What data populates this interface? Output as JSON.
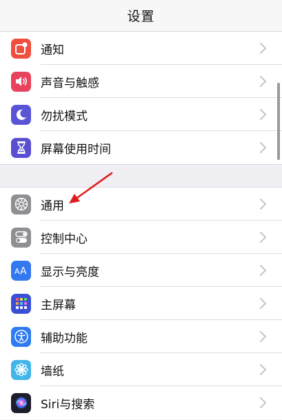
{
  "nav": {
    "title": "设置"
  },
  "group1": [
    {
      "label": "通知",
      "icon": "notifications-icon",
      "color": "#ee4f3e"
    },
    {
      "label": "声音与触感",
      "icon": "sound-icon",
      "color": "#e8435d"
    },
    {
      "label": "勿扰模式",
      "icon": "moon-icon",
      "color": "#5a55d6"
    },
    {
      "label": "屏幕使用时间",
      "icon": "hourglass-icon",
      "color": "#5a4fd1"
    }
  ],
  "group2": [
    {
      "label": "通用",
      "icon": "gear-icon",
      "color": "#8e8e93"
    },
    {
      "label": "控制中心",
      "icon": "toggles-icon",
      "color": "#8e8e93"
    },
    {
      "label": "显示与亮度",
      "icon": "text-size-icon",
      "color": "#3478f0"
    },
    {
      "label": "主屏幕",
      "icon": "home-grid-icon",
      "color": "#3a4fd6"
    },
    {
      "label": "辅助功能",
      "icon": "accessibility-icon",
      "color": "#2f7cf0"
    },
    {
      "label": "墙纸",
      "icon": "wallpaper-flower-icon",
      "color": "#42b6e8"
    },
    {
      "label": "Siri与搜索",
      "icon": "siri-icon",
      "color": "#1d1d2b"
    }
  ],
  "annotation": {
    "arrow_color": "#e01b1b"
  }
}
